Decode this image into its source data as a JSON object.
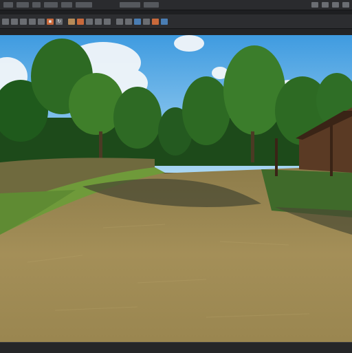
{
  "menubar": {
    "items": [
      "menu-1",
      "menu-2",
      "menu-3",
      "menu-4",
      "menu-5",
      "menu-6",
      "menu-7",
      "menu-8"
    ],
    "window_controls": [
      "window-control-1",
      "window-control-2",
      "window-control-3",
      "window-control-4"
    ]
  },
  "toolbar": {
    "icons": [
      {
        "name": "layout-icon",
        "kind": "gray",
        "glyph": ""
      },
      {
        "name": "panel-icon",
        "kind": "gray",
        "glyph": ""
      },
      {
        "name": "grid-icon",
        "kind": "gray",
        "glyph": ""
      },
      {
        "name": "view-icon",
        "kind": "gray",
        "glyph": ""
      },
      {
        "name": "camera-icon",
        "kind": "gray",
        "glyph": ""
      },
      {
        "name": "record-icon",
        "kind": "orange",
        "glyph": "▪"
      },
      {
        "name": "refresh-icon",
        "kind": "gray",
        "glyph": "↻"
      },
      {
        "name": "material-icon",
        "kind": "tan",
        "glyph": "",
        "sep": true
      },
      {
        "name": "light-icon",
        "kind": "orange",
        "glyph": ""
      },
      {
        "name": "object-icon",
        "kind": "gray",
        "glyph": ""
      },
      {
        "name": "mesh-icon",
        "kind": "gray",
        "glyph": ""
      },
      {
        "name": "brush-icon",
        "kind": "gray",
        "glyph": ""
      },
      {
        "name": "terrain-icon",
        "kind": "gray",
        "glyph": "",
        "sep": true
      },
      {
        "name": "foliage-icon",
        "kind": "gray",
        "glyph": ""
      },
      {
        "name": "render-icon",
        "kind": "blue",
        "glyph": ""
      },
      {
        "name": "settings-icon",
        "kind": "gray",
        "glyph": ""
      },
      {
        "name": "snapshot-icon",
        "kind": "orange",
        "glyph": ""
      },
      {
        "name": "export-icon",
        "kind": "blue",
        "glyph": ""
      }
    ]
  },
  "viewport": {
    "scene": "outdoor-dirt-path",
    "colors": {
      "sky_top": "#3f9be0",
      "sky_bottom": "#a9d7f3",
      "trees": "#1f5a1c",
      "trees_light": "#4c8e2e",
      "ground": "#9e8b55",
      "ground_dark": "#6f6038",
      "shadow": "#4a4a33",
      "grass": "#6f9a3a",
      "barn": "#5a3a24"
    }
  }
}
